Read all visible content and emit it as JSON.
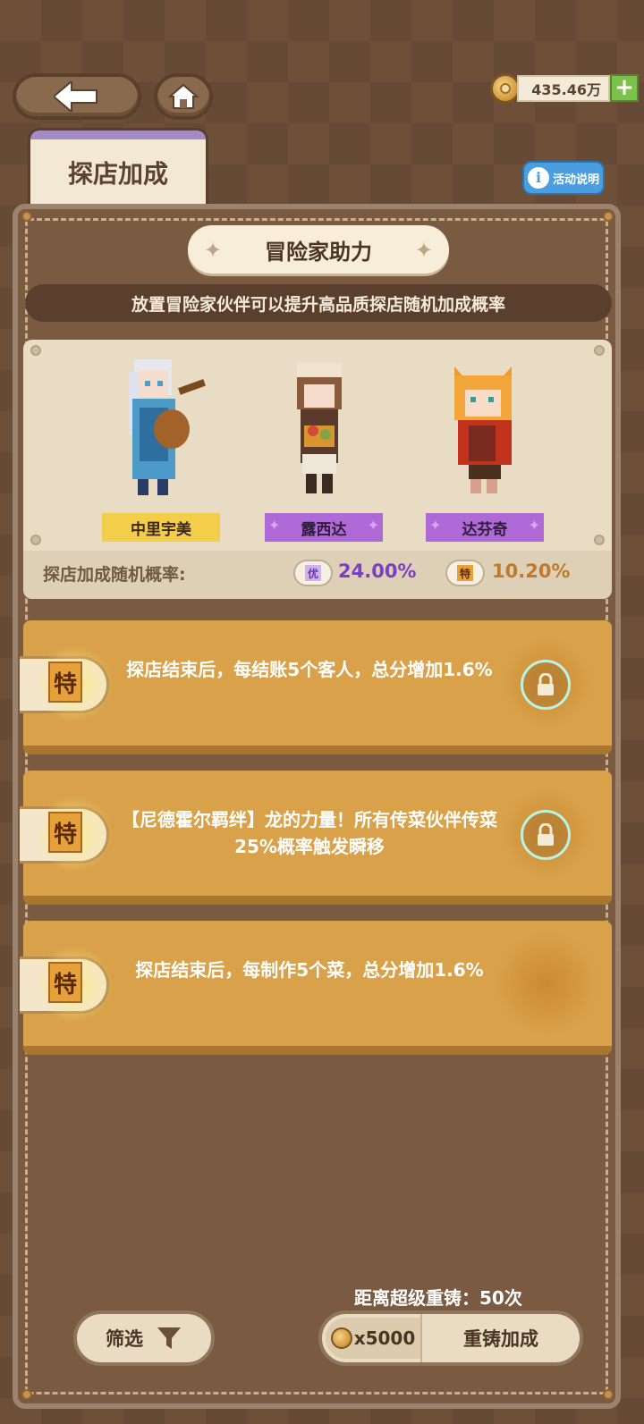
{
  "currency": {
    "amount": "435.46万",
    "plus": "+"
  },
  "tab": {
    "label": "探店加成"
  },
  "help": {
    "icon_char": "i",
    "label": "活动说明"
  },
  "header": {
    "title": "冒险家助力",
    "subtitle": "放置冒险家伙伴可以提升高品质探店随机加成概率"
  },
  "adventurers": [
    {
      "name": "中里宇美",
      "tag_color": "#f4cd4a"
    },
    {
      "name": "露西达",
      "tag_color": "#b06ad8"
    },
    {
      "name": "达芬奇",
      "tag_color": "#b06ad8"
    }
  ],
  "rates": {
    "label": "探店加成随机概率:",
    "items": [
      {
        "badge": "优",
        "value": "24.00%",
        "color": "#7a3fc2"
      },
      {
        "badge": "特",
        "value": "10.20%",
        "color": "#c07a2e"
      }
    ]
  },
  "bonuses": [
    {
      "grade": "特",
      "text": "探店结束后，每结账5个客人，总分增加1.6%",
      "locked": true
    },
    {
      "grade": "特",
      "text": "【尼德霍尔羁绊】龙的力量！所有传菜伙伴传菜25%概率触发瞬移",
      "locked": true
    },
    {
      "grade": "特",
      "text": "探店结束后，每制作5个菜，总分增加1.6%",
      "locked": false
    }
  ],
  "footer": {
    "reroll_count": "距离超级重铸：50次",
    "filter_label": "筛选",
    "reroll_cost": "x5000",
    "reroll_label": "重铸加成"
  },
  "icons": [
    "back-arrow-icon",
    "home-icon",
    "coin-icon",
    "plus-icon",
    "info-icon",
    "lock-icon",
    "filter-funnel-icon"
  ]
}
